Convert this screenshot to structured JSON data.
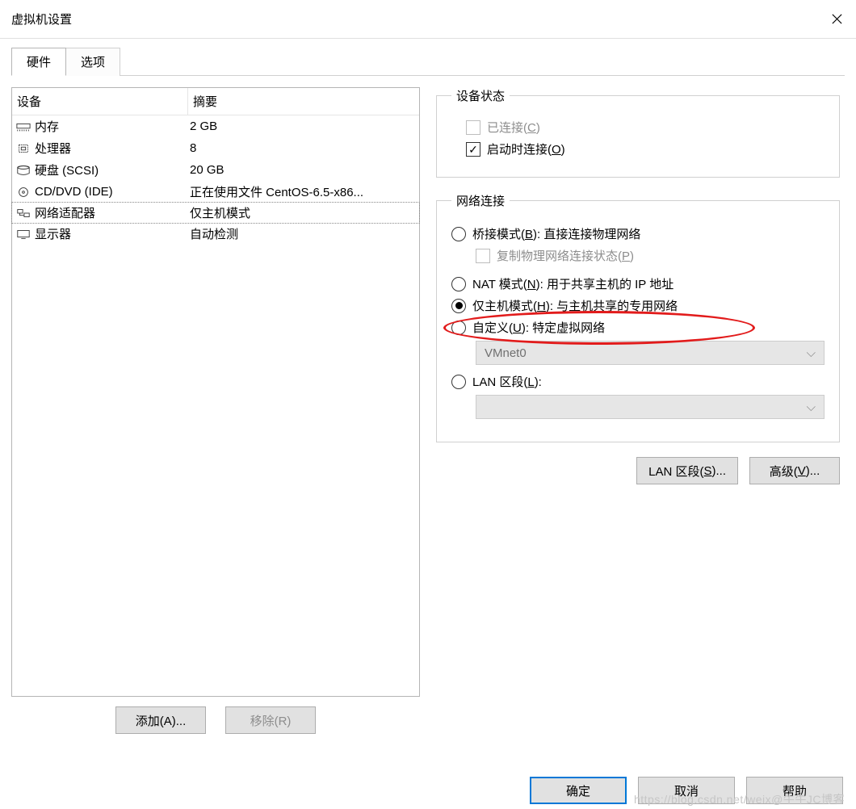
{
  "window": {
    "title": "虚拟机设置"
  },
  "tabs": {
    "hardware": "硬件",
    "options": "选项"
  },
  "device_list": {
    "col_device": "设备",
    "col_summary": "摘要",
    "rows": [
      {
        "icon": "memory-icon",
        "name": "内存",
        "summary": "2 GB"
      },
      {
        "icon": "cpu-icon",
        "name": "处理器",
        "summary": "8"
      },
      {
        "icon": "disk-icon",
        "name": "硬盘 (SCSI)",
        "summary": "20 GB"
      },
      {
        "icon": "cd-icon",
        "name": "CD/DVD (IDE)",
        "summary": "正在使用文件 CentOS-6.5-x86..."
      },
      {
        "icon": "network-icon",
        "name": "网络适配器",
        "summary": "仅主机模式"
      },
      {
        "icon": "display-icon",
        "name": "显示器",
        "summary": "自动检测"
      }
    ],
    "selected_index": 4
  },
  "left_buttons": {
    "add": "添加(A)...",
    "remove": "移除(R)"
  },
  "device_status": {
    "legend": "设备状态",
    "connected": "已连接(C)",
    "connect_at_power_on": "启动时连接(O)"
  },
  "network": {
    "legend": "网络连接",
    "bridged": "桥接模式(B): 直接连接物理网络",
    "replicate": "复制物理网络连接状态(P)",
    "nat": "NAT 模式(N): 用于共享主机的 IP 地址",
    "hostonly": "仅主机模式(H): 与主机共享的专用网络",
    "custom": "自定义(U): 特定虚拟网络",
    "custom_value": "VMnet0",
    "lan_segment": "LAN 区段(L):",
    "lan_segment_value": ""
  },
  "right_buttons": {
    "lan_segments": "LAN 区段(S)...",
    "advanced": "高级(V)..."
  },
  "footer": {
    "ok": "确定",
    "cancel": "取消",
    "help": "帮助"
  },
  "watermark": "https://blog.csdn.net/weix@牛牛JC博客"
}
